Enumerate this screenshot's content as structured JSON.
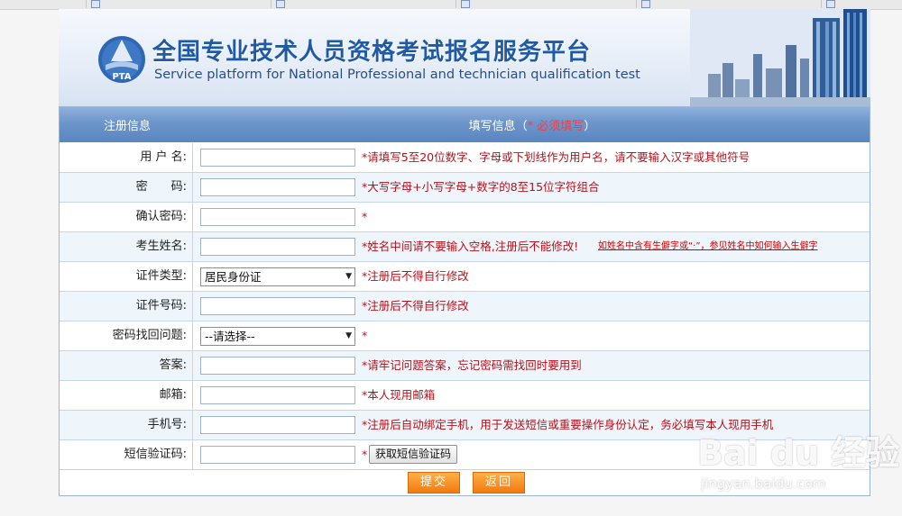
{
  "header": {
    "title_cn": "全国专业技术人员资格考试报名服务平台",
    "title_en": "Service platform for National Professional and technician  qualification test",
    "logo_text": "PTA"
  },
  "form": {
    "col_label": "注册信息",
    "col_fill": "填写信息（",
    "col_fill_required": "* 必须填写",
    "col_fill_end": "）",
    "rows": [
      {
        "label": "用 户 名:",
        "hint": "*请填写5至20位数字、字母或下划线作为用户名，请不要输入汉字或其他符号"
      },
      {
        "label": "密　　码:",
        "hint": "*大写字母+小写字母+数字的8至15位字符组合"
      },
      {
        "label": "确认密码:",
        "hint": "*"
      },
      {
        "label": "考生姓名:",
        "hint": "*姓名中间请不要输入空格,注册后不能修改!",
        "link": "如姓名中含有生僻字或“·”，参见姓名中如何输入生僻字"
      },
      {
        "label": "证件类型:",
        "select_value": "居民身份证",
        "hint": "*注册后不得自行修改"
      },
      {
        "label": "证件号码:",
        "hint": "*注册后不得自行修改"
      },
      {
        "label": "密码找回问题:",
        "select_value": "--请选择--",
        "hint": "*"
      },
      {
        "label": "答案:",
        "hint": "*请牢记问题答案，忘记密码需找回时要用到"
      },
      {
        "label": "邮箱:",
        "hint": "*本人现用邮箱"
      },
      {
        "label": "手机号:",
        "hint": "*注册后自动绑定手机，用于发送短信或重要操作身份认定，务必填写本人现用手机"
      },
      {
        "label": "短信验证码:",
        "hint": "*",
        "button": "获取短信验证码"
      }
    ],
    "submit_label": "提交",
    "back_label": "返回"
  },
  "watermark": {
    "logo": "Bai du 经验",
    "url": "jingyan.baidu.com"
  },
  "colors": {
    "accent": "#5a86c1",
    "hint_red": "#b5121b",
    "button_orange": "#f07a10"
  }
}
